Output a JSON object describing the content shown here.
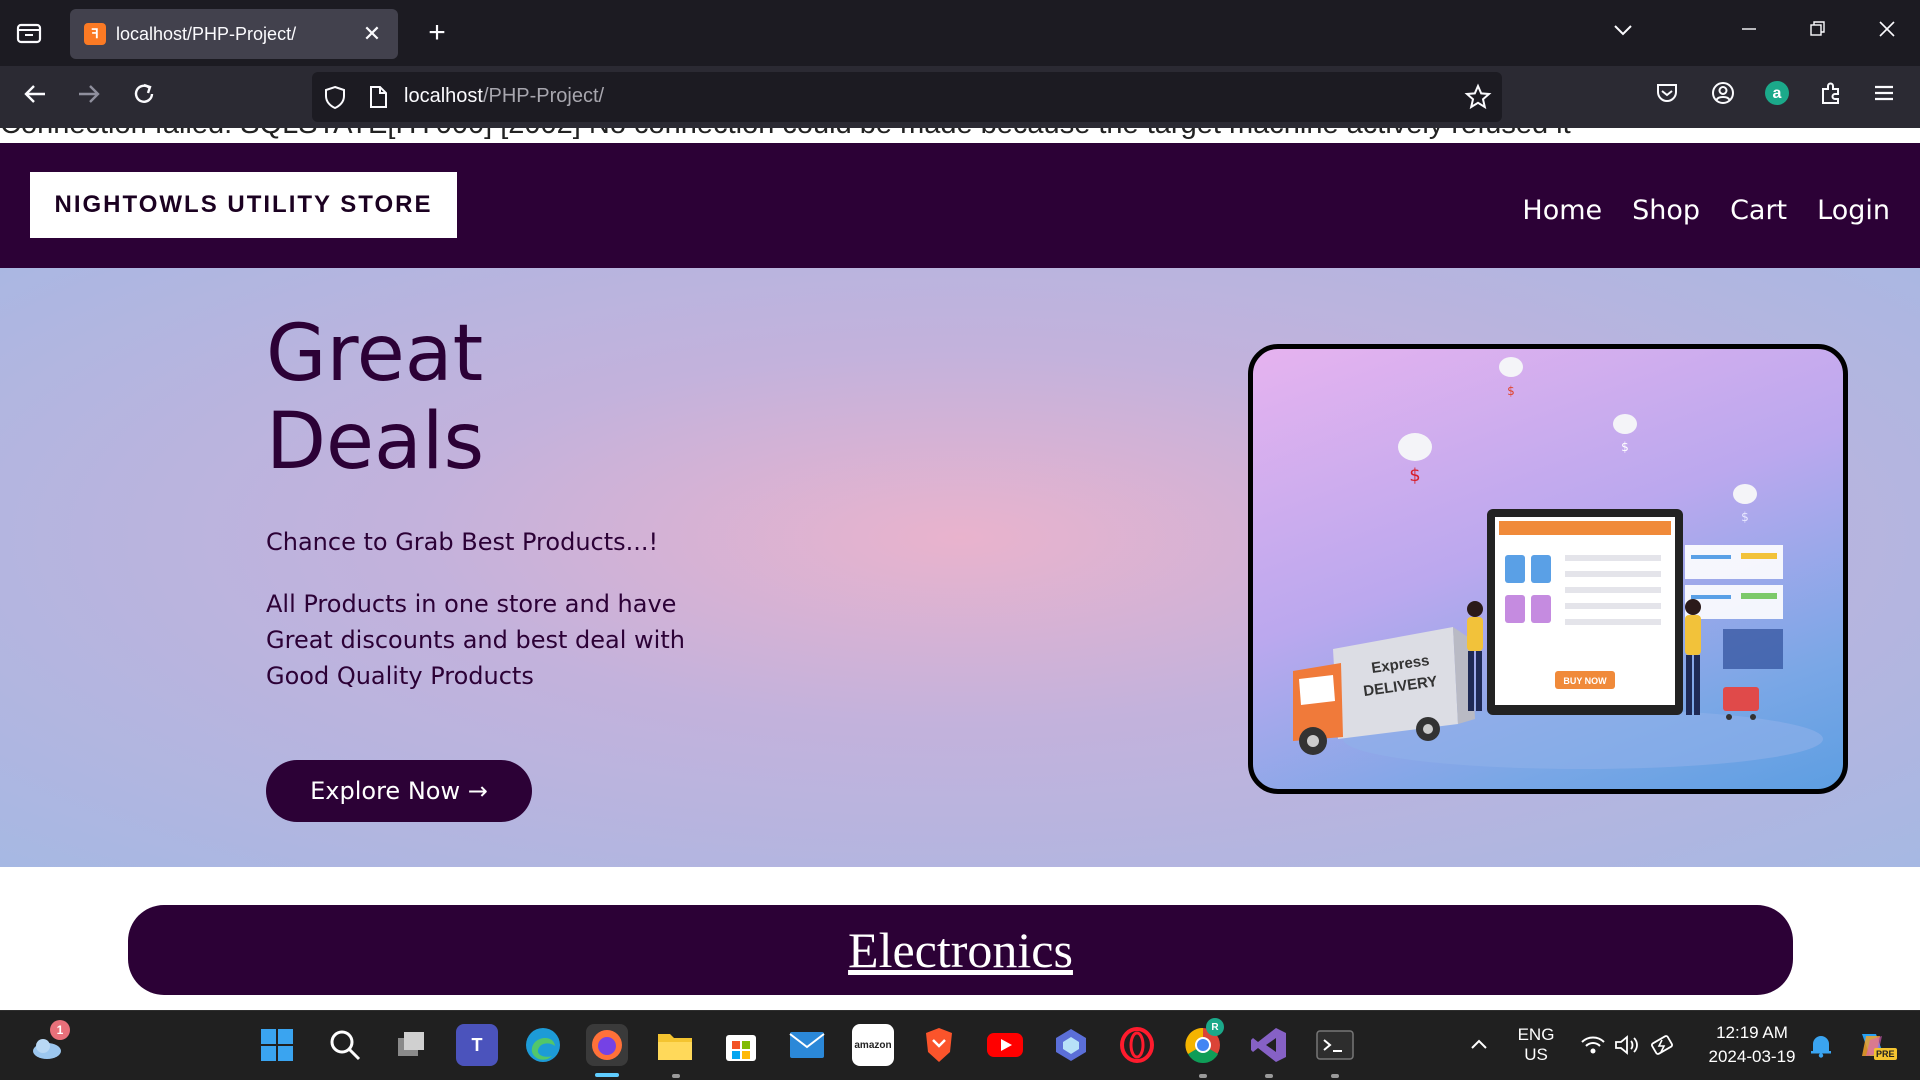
{
  "browser": {
    "tab_title": "localhost/PHP-Project/",
    "tab_close": "✕",
    "new_tab": "+",
    "url_host": "localhost",
    "url_path": "/PHP-Project/"
  },
  "page": {
    "error_message": "Connection failed: SQLSTATE[HY000] [2002] No connection could be made because the target machine actively refused it",
    "logo": "NIGHTOWLS UTILITY STORE",
    "nav": [
      "Home",
      "Shop",
      "Cart",
      "Login"
    ],
    "hero": {
      "title": "Great Deals",
      "subtitle": "Chance to Grab Best Products...!",
      "description": "All Products in one store and have Great discounts and best deal with Good Quality Products",
      "button": "Explore Now →"
    },
    "illustration": {
      "truck_text_1": "Express",
      "truck_text_2": "DELIVERY",
      "buy_button": "BUY NOW"
    },
    "category": "Electronics"
  },
  "taskbar": {
    "weather_badge": "1",
    "language_line1": "ENG",
    "language_line2": "US",
    "time": "12:19 AM",
    "date": "2024-03-19",
    "chrome_badge": "R",
    "copilot_badge": "PRE"
  }
}
